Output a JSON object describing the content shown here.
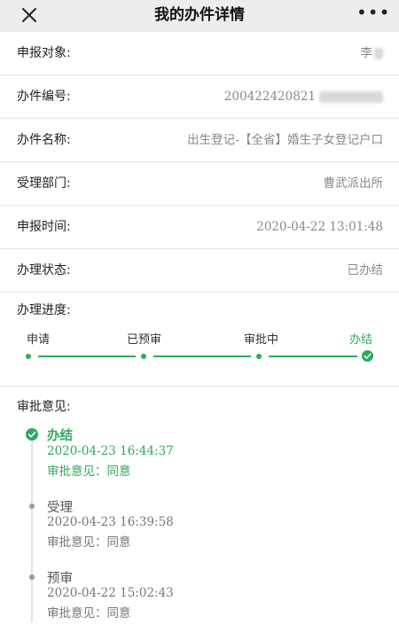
{
  "header": {
    "title": "我的办件详情",
    "close_icon": "close-icon",
    "more_icon": "more-icon",
    "more_label": "•••"
  },
  "details": [
    {
      "label": "申报对象:",
      "value": "李"
    },
    {
      "label": "办件编号:",
      "value": "200422420821"
    },
    {
      "label": "办件名称:",
      "value": "出生登记-【全省】婚生子女登记户口"
    },
    {
      "label": "受理部门:",
      "value": "曹武派出所"
    },
    {
      "label": "申报时间:",
      "value": "2020-04-22 13:01:48"
    },
    {
      "label": "办理状态:",
      "value": "已办结"
    }
  ],
  "progress": {
    "label": "办理进度:",
    "steps": [
      "申请",
      "已预审",
      "审批中",
      "办结"
    ],
    "current_step": 4,
    "color": "#2eaa5c"
  },
  "opinions": {
    "label": "审批意见:",
    "items": [
      {
        "title": "办结",
        "time": "2020-04-23 16:44:37",
        "note": "审批意见：同意"
      },
      {
        "title": "受理",
        "time": "2020-04-23 16:39:58",
        "note": "审批意见：同意"
      },
      {
        "title": "预审",
        "time": "2020-04-22 15:02:43",
        "note": "审批意见：同意"
      }
    ]
  }
}
